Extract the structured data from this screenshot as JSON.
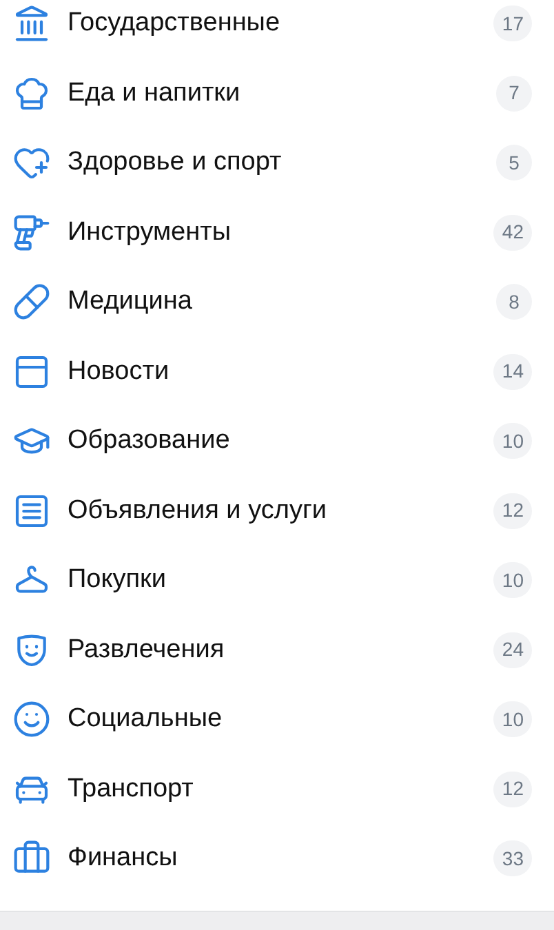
{
  "categories": [
    {
      "label": "Государственные",
      "count": "17"
    },
    {
      "label": "Еда и напитки",
      "count": "7"
    },
    {
      "label": "Здоровье и спорт",
      "count": "5"
    },
    {
      "label": "Инструменты",
      "count": "42"
    },
    {
      "label": "Медицина",
      "count": "8"
    },
    {
      "label": "Новости",
      "count": "14"
    },
    {
      "label": "Образование",
      "count": "10"
    },
    {
      "label": "Объявления и услуги",
      "count": "12"
    },
    {
      "label": "Покупки",
      "count": "10"
    },
    {
      "label": "Развлечения",
      "count": "24"
    },
    {
      "label": "Социальные",
      "count": "10"
    },
    {
      "label": "Транспорт",
      "count": "12"
    },
    {
      "label": "Финансы",
      "count": "33"
    }
  ]
}
